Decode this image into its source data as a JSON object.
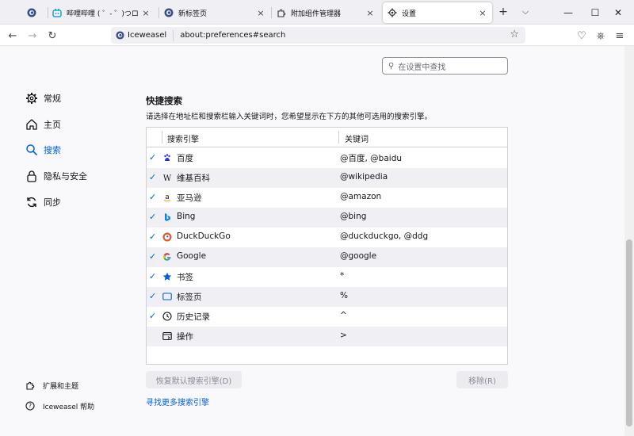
{
  "tabs": [
    {
      "label": "",
      "close": ""
    },
    {
      "label": "哔哩哔哩 ( ゜- ゜)つロ 千杯…",
      "close": "×"
    },
    {
      "label": "新标签页",
      "close": "×"
    },
    {
      "label": "附加组件管理器",
      "close": "×"
    },
    {
      "label": "设置",
      "close": "×"
    }
  ],
  "tabstrip": {
    "new_tab": "+",
    "list_tabs": "⌵",
    "minimize": "—",
    "maximize": "☐",
    "close": "✕"
  },
  "navbar": {
    "back": "←",
    "forward": "→",
    "reload": "↻",
    "identity_label": "Iceweasel",
    "url": "about:preferences#search",
    "bookmark_star": "☆",
    "pocket": "♡",
    "extensions": "⎈",
    "menu": "≡"
  },
  "search": {
    "placeholder": "在设置中查找",
    "icon": "search-icon"
  },
  "categories": [
    {
      "label": "常规",
      "icon": "gear-icon"
    },
    {
      "label": "主页",
      "icon": "home-icon"
    },
    {
      "label": "搜索",
      "icon": "search-icon"
    },
    {
      "label": "隐私与安全",
      "icon": "lock-icon"
    },
    {
      "label": "同步",
      "icon": "sync-icon"
    }
  ],
  "footer_links": [
    {
      "label": "扩展和主题",
      "icon": "puzzle-icon"
    },
    {
      "label": "Iceweasel 帮助",
      "icon": "help-icon"
    }
  ],
  "section": {
    "title": "快捷搜索",
    "description": "请选择在地址栏和搜索栏输入关键词时，您希望显示在下方的其他可选用的搜索引擎。"
  },
  "table": {
    "headers": [
      "搜索引擎",
      "关键词"
    ],
    "rows": [
      {
        "checked": true,
        "name": "百度",
        "keyword": "@百度, @baidu",
        "icon": "baidu-icon"
      },
      {
        "checked": true,
        "name": "维基百科",
        "keyword": "@wikipedia",
        "icon": "wikipedia-icon"
      },
      {
        "checked": true,
        "name": "亚马逊",
        "keyword": "@amazon",
        "icon": "amazon-icon"
      },
      {
        "checked": true,
        "name": "Bing",
        "keyword": "@bing",
        "icon": "bing-icon"
      },
      {
        "checked": true,
        "name": "DuckDuckGo",
        "keyword": "@duckduckgo, @ddg",
        "icon": "duckduckgo-icon"
      },
      {
        "checked": true,
        "name": "Google",
        "keyword": "@google",
        "icon": "google-icon"
      },
      {
        "checked": true,
        "name": "书签",
        "keyword": "*",
        "icon": "star-icon"
      },
      {
        "checked": true,
        "name": "标签页",
        "keyword": "%",
        "icon": "tab-icon"
      },
      {
        "checked": true,
        "name": "历史记录",
        "keyword": "^",
        "icon": "clock-icon"
      },
      {
        "checked": false,
        "name": "操作",
        "keyword": ">",
        "icon": "actions-icon"
      }
    ],
    "check_glyph": "✓"
  },
  "buttons": {
    "restore_defaults": "恢复默认搜索引擎(D)",
    "remove": "移除(R)"
  },
  "find_more": "寻找更多搜索引擎",
  "colors": {
    "accent": "#0061e0",
    "row_alt": "#f0f0f4"
  }
}
